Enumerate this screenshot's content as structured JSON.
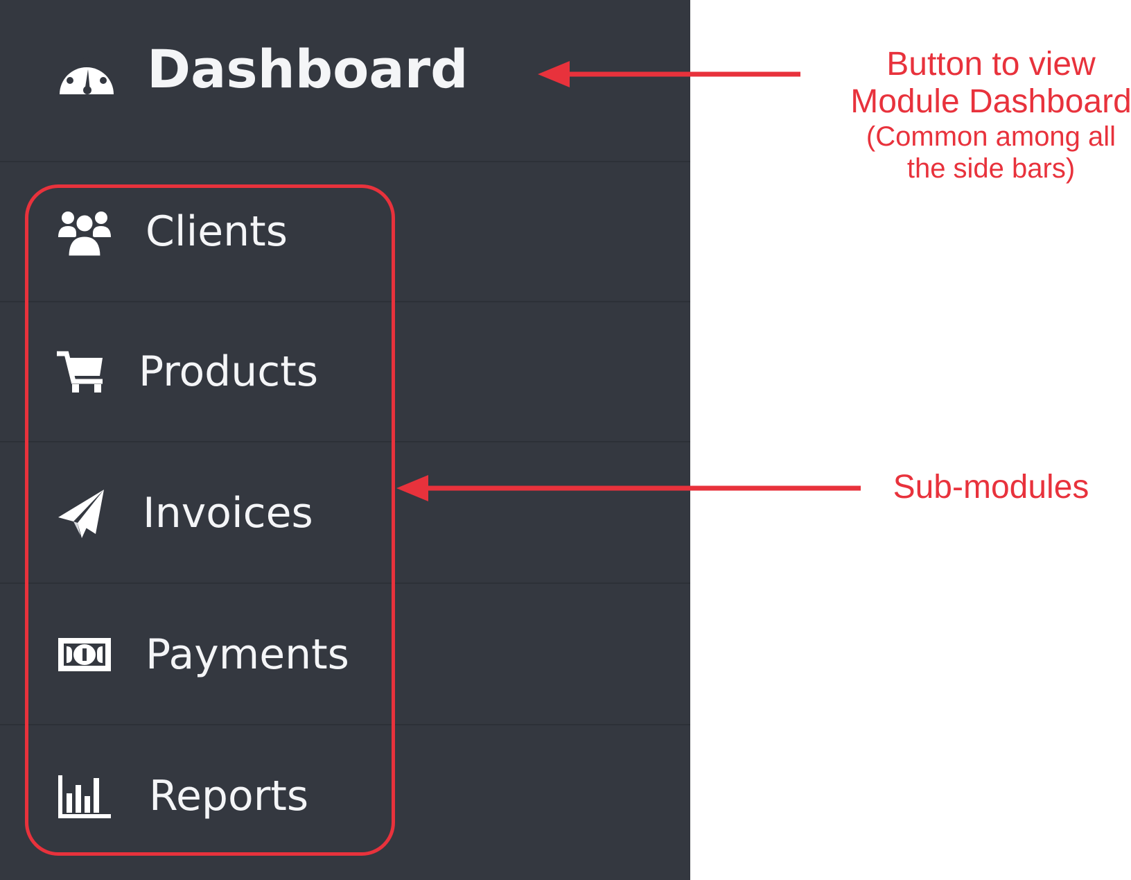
{
  "sidebar": {
    "dashboard": {
      "label": "Dashboard",
      "icon": "tachometer-icon"
    },
    "items": [
      {
        "label": "Clients",
        "icon": "users-icon"
      },
      {
        "label": "Products",
        "icon": "shopping-cart-icon"
      },
      {
        "label": "Invoices",
        "icon": "paper-plane-icon"
      },
      {
        "label": "Payments",
        "icon": "money-bill-icon"
      },
      {
        "label": "Reports",
        "icon": "bar-chart-icon"
      }
    ]
  },
  "annotations": {
    "dashboard_line1": "Button to view",
    "dashboard_line2": "Module Dashboard",
    "dashboard_line3": "(Common among all",
    "dashboard_line4": "the side bars)",
    "submodules": "Sub-modules"
  },
  "colors": {
    "sidebar_bg": "#343840",
    "sidebar_text": "#f4f5f7",
    "annotation": "#e8323c"
  }
}
